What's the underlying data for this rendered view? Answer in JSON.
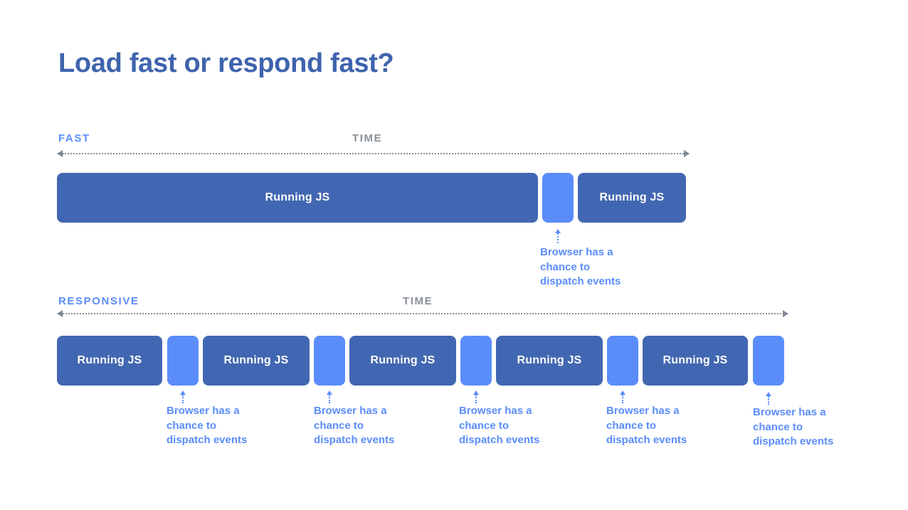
{
  "slide": {
    "title": "Load fast or respond fast?",
    "background_color": "#ffffff",
    "title_color": "#3f63ad"
  },
  "colors": {
    "busy_block": "#4267b2",
    "idle_block": "#5b8dfa",
    "accent_label": "#5b8dfa",
    "muted_label": "#8a909a",
    "axis_line": "#7e8692",
    "block_text": "#ffffff"
  },
  "labels": {
    "busy_block_text": "Running JS",
    "callout_text": "Browser has a\nchance to\ndispatch events",
    "time_axis": "TIME"
  },
  "sections": [
    {
      "name": "fast",
      "mode_label": "FAST",
      "time_label": "TIME",
      "axis": {
        "left_arrow": true,
        "right_arrow": true
      },
      "blocks": [
        {
          "type": "busy",
          "label": "Running JS"
        },
        {
          "type": "idle",
          "label": ""
        },
        {
          "type": "busy",
          "label": "Running JS"
        }
      ],
      "callouts": [
        {
          "text": "Browser has a\nchance to\ndispatch events"
        }
      ]
    },
    {
      "name": "responsive",
      "mode_label": "RESPONSIVE",
      "time_label": "TIME",
      "axis": {
        "left_arrow": true,
        "right_arrow": true
      },
      "blocks": [
        {
          "type": "busy",
          "label": "Running JS"
        },
        {
          "type": "idle",
          "label": ""
        },
        {
          "type": "busy",
          "label": "Running JS"
        },
        {
          "type": "idle",
          "label": ""
        },
        {
          "type": "busy",
          "label": "Running JS"
        },
        {
          "type": "idle",
          "label": ""
        },
        {
          "type": "busy",
          "label": "Running JS"
        },
        {
          "type": "idle",
          "label": ""
        },
        {
          "type": "busy",
          "label": "Running JS"
        },
        {
          "type": "idle",
          "label": ""
        }
      ],
      "callouts": [
        {
          "text": "Browser has a\nchance to\ndispatch events"
        },
        {
          "text": "Browser has a\nchance to\ndispatch events"
        },
        {
          "text": "Browser has a\nchance to\ndispatch events"
        },
        {
          "text": "Browser has a\nchance to\ndispatch events"
        },
        {
          "text": "Browser has a\nchance to\ndispatch events"
        }
      ]
    }
  ],
  "chart_data": {
    "type": "bar",
    "title": "Load fast or respond fast?",
    "xlabel": "TIME",
    "ylabel": "",
    "orientation": "horizontal-timeline",
    "series": [
      {
        "name": "FAST",
        "row": 1,
        "segments": [
          {
            "state": "Running JS",
            "start": 80,
            "end": 756,
            "duration": 676
          },
          {
            "state": "Browser has a chance to dispatch events",
            "start": 762,
            "end": 806,
            "duration": 44
          },
          {
            "state": "Running JS",
            "start": 812,
            "end": 964,
            "duration": 152
          }
        ]
      },
      {
        "name": "RESPONSIVE",
        "row": 2,
        "segments": [
          {
            "state": "Running JS",
            "start": 80,
            "end": 228,
            "duration": 148
          },
          {
            "state": "Browser has a chance to dispatch events",
            "start": 235,
            "end": 279,
            "duration": 44
          },
          {
            "state": "Running JS",
            "start": 285,
            "end": 435,
            "duration": 150
          },
          {
            "state": "Browser has a chance to dispatch events",
            "start": 441,
            "end": 485,
            "duration": 44
          },
          {
            "state": "Running JS",
            "start": 491,
            "end": 641,
            "duration": 150
          },
          {
            "state": "Browser has a chance to dispatch events",
            "start": 647,
            "end": 691,
            "duration": 44
          },
          {
            "state": "Running JS",
            "start": 697,
            "end": 847,
            "duration": 150
          },
          {
            "state": "Browser has a chance to dispatch events",
            "start": 853,
            "end": 897,
            "duration": 44
          },
          {
            "state": "Running JS",
            "start": 903,
            "end": 1051,
            "duration": 148
          },
          {
            "state": "Browser has a chance to dispatch events",
            "start": 1058,
            "end": 1102,
            "duration": 44
          }
        ]
      }
    ],
    "legend": [
      "Running JS",
      "Browser has a chance to dispatch events"
    ],
    "grid": false
  }
}
